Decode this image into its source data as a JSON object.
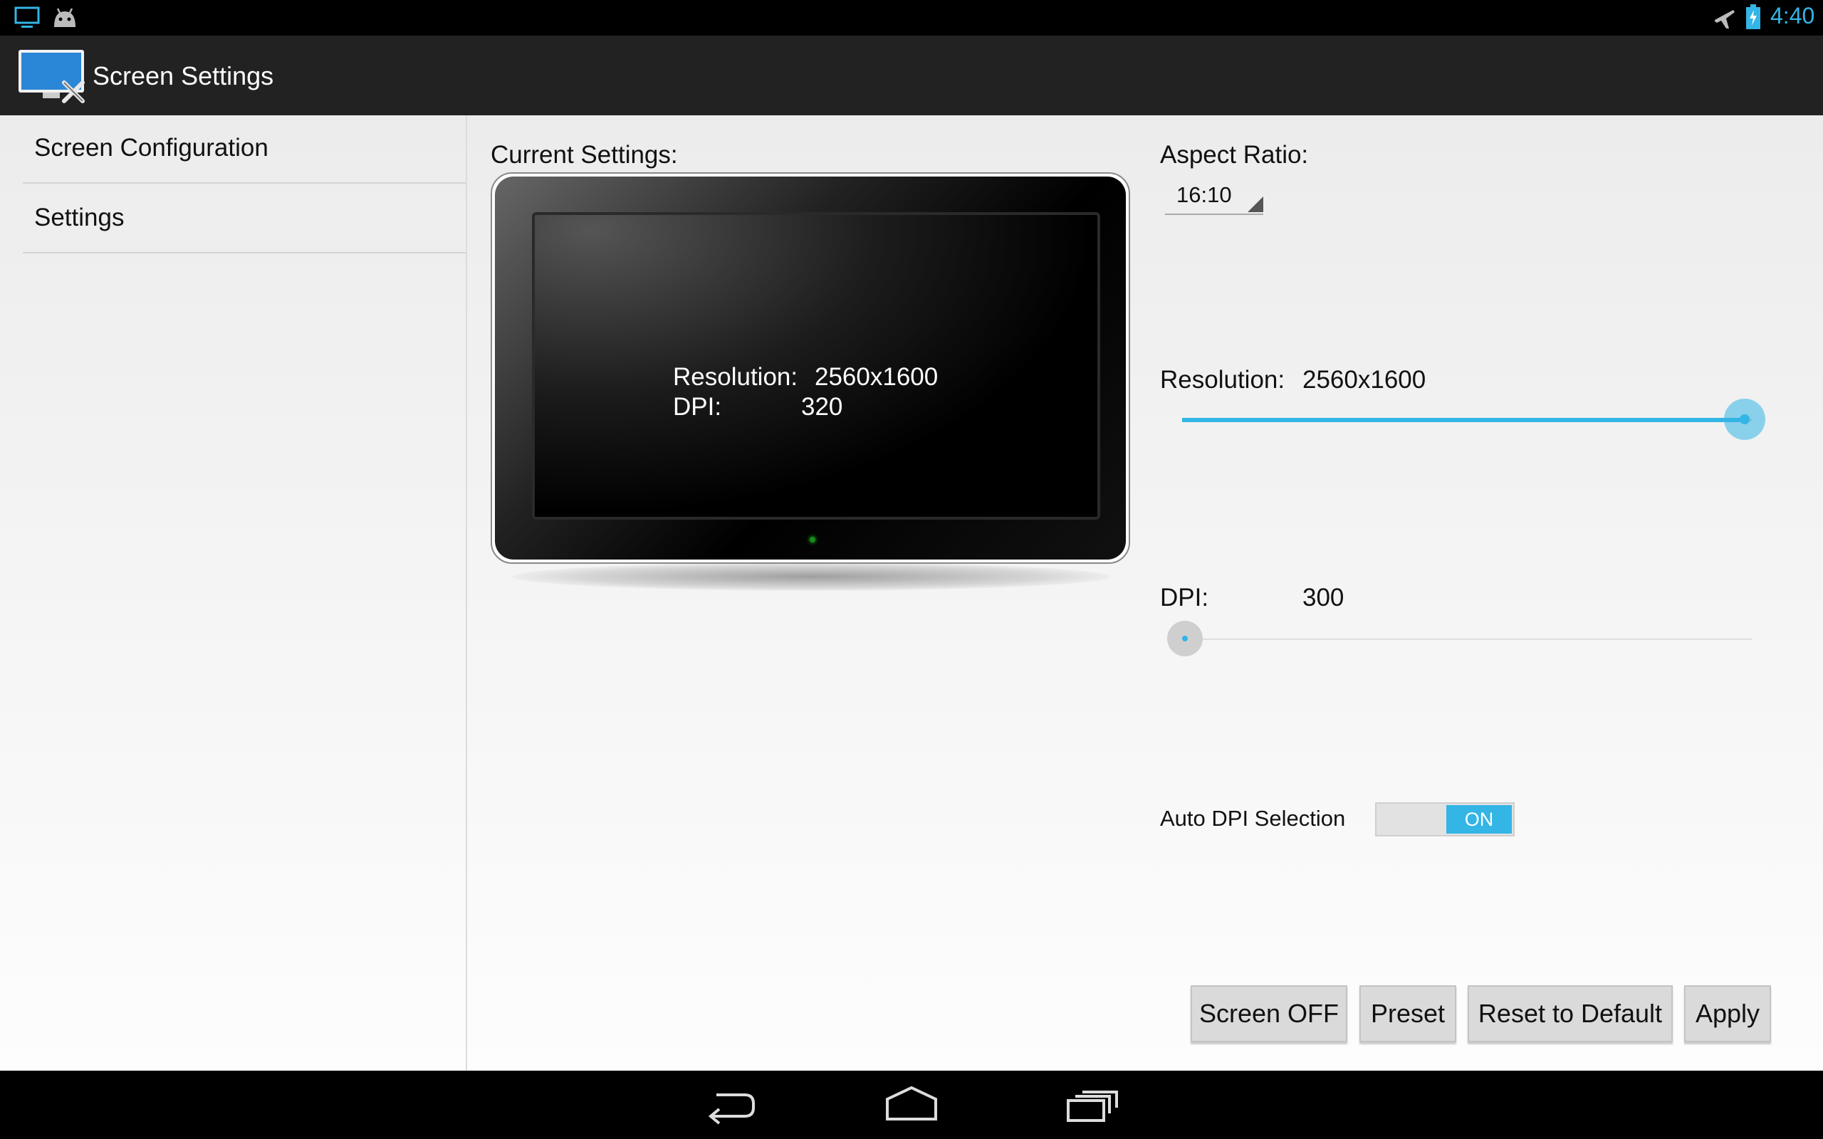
{
  "status_bar": {
    "time": "4:40",
    "left_icons": [
      "monitor-icon",
      "android-icon"
    ],
    "right_icons": [
      "airplane-mode-icon",
      "battery-charging-icon"
    ],
    "accent_color": "#33b5e5"
  },
  "action_bar": {
    "title": "Screen Settings",
    "icon": "screen-settings-app-icon"
  },
  "sidebar": {
    "items": [
      {
        "label": "Screen Configuration"
      },
      {
        "label": "Settings"
      }
    ]
  },
  "current_settings": {
    "label": "Current Settings:",
    "resolution_label": "Resolution:",
    "resolution_value": "2560x1600",
    "dpi_label": "DPI:",
    "dpi_value": "320"
  },
  "aspect_ratio": {
    "label": "Aspect Ratio:",
    "selected": "16:10"
  },
  "resolution": {
    "label": "Resolution:",
    "value": "2560x1600",
    "slider_fraction": 1.0
  },
  "dpi": {
    "label": "DPI:",
    "value": "300",
    "slider_fraction": 0.0
  },
  "auto_dpi": {
    "label": "Auto DPI Selection",
    "state": "ON"
  },
  "buttons": {
    "screen_off": "Screen OFF",
    "preset": "Preset",
    "reset": "Reset to Default",
    "apply": "Apply"
  },
  "nav_bar": {
    "icons": [
      "back-icon",
      "home-icon",
      "recent-apps-icon"
    ]
  }
}
